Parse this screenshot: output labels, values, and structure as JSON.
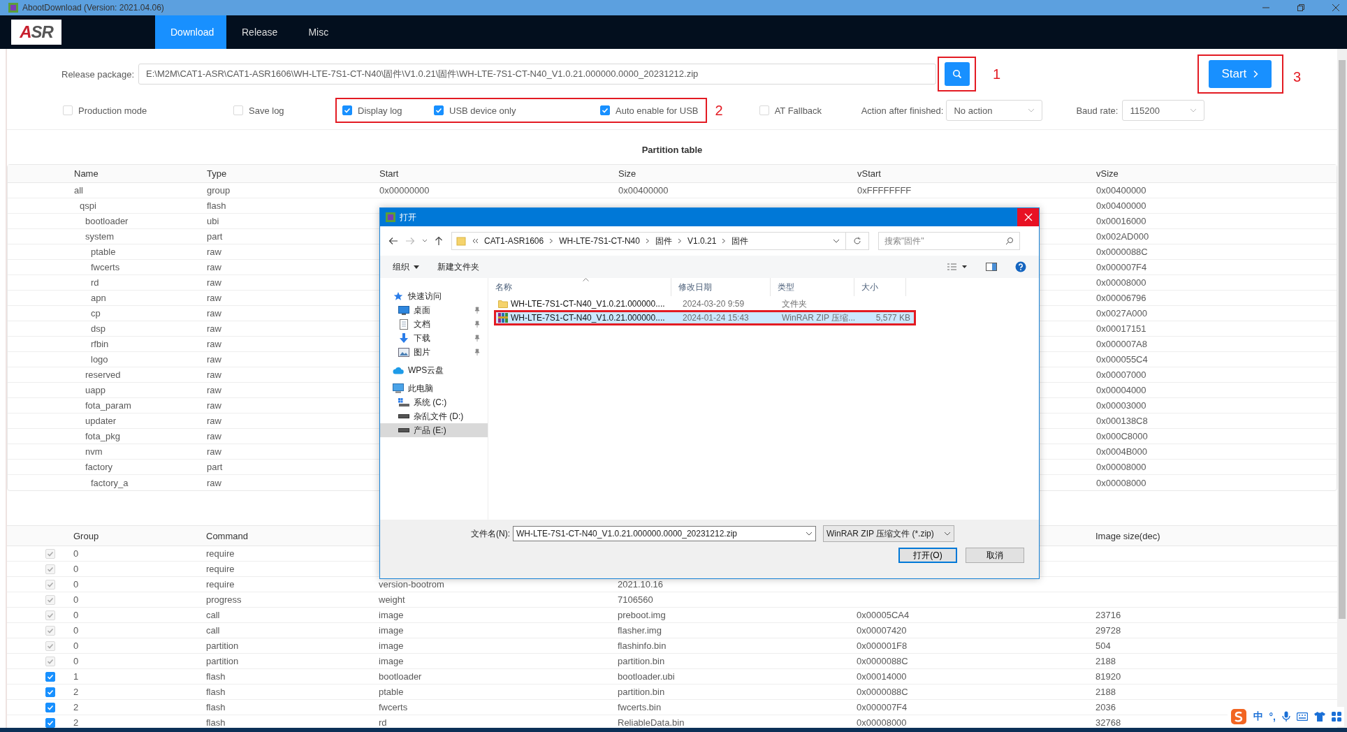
{
  "window": {
    "title": "AbootDownload (Version: 2021.04.06)"
  },
  "logo": {
    "text": "ASR"
  },
  "tabs": [
    {
      "label": "Download",
      "selected": true
    },
    {
      "label": "Release",
      "selected": false
    },
    {
      "label": "Misc",
      "selected": false
    }
  ],
  "release_package": {
    "label": "Release package:",
    "value": "E:\\M2M\\CAT1-ASR\\CAT1-ASR1606\\WH-LTE-7S1-CT-N40\\固件\\V1.0.21\\固件\\WH-LTE-7S1-CT-N40_V1.0.21.000000.0000_20231212.zip",
    "annotation": "1"
  },
  "start_button": {
    "label": "Start",
    "annotation": "3"
  },
  "options": [
    {
      "label": "Production mode",
      "checked": false,
      "highlighted": false
    },
    {
      "label": "Save log",
      "checked": false,
      "highlighted": false
    },
    {
      "label": "Display log",
      "checked": true,
      "highlighted": true
    },
    {
      "label": "USB device only",
      "checked": true,
      "highlighted": true
    },
    {
      "label": "Auto enable for USB",
      "checked": true,
      "highlighted": true
    },
    {
      "label": "AT Fallback",
      "checked": false,
      "highlighted": false
    }
  ],
  "options_annotation": "2",
  "action_after_finished": {
    "label": "Action after finished:",
    "value": "No action"
  },
  "baud_rate": {
    "label": "Baud rate:",
    "value": "115200"
  },
  "partition_table": {
    "title": "Partition table",
    "columns": {
      "name": "Name",
      "type": "Type",
      "start": "Start",
      "size": "Size",
      "vstart": "vStart",
      "vsize": "vSize"
    },
    "rows": [
      {
        "name": "all",
        "type": "group",
        "start": "0x00000000",
        "size": "0x00400000",
        "vstart": "0xFFFFFFFF",
        "vsize": "0x00400000",
        "children": [
          {
            "name": "qspi",
            "type": "flash",
            "vsize": "0x00400000",
            "children": [
              {
                "name": "bootloader",
                "type": "ubi",
                "vsize": "0x00016000"
              },
              {
                "name": "system",
                "type": "part",
                "vsize": "0x002AD000",
                "children": [
                  {
                    "name": "ptable",
                    "type": "raw",
                    "vsize": "0x0000088C"
                  },
                  {
                    "name": "fwcerts",
                    "type": "raw",
                    "vsize": "0x000007F4"
                  },
                  {
                    "name": "rd",
                    "type": "raw",
                    "vsize": "0x00008000"
                  },
                  {
                    "name": "apn",
                    "type": "raw",
                    "vsize": "0x00006796"
                  },
                  {
                    "name": "cp",
                    "type": "raw",
                    "vsize": "0x0027A000"
                  },
                  {
                    "name": "dsp",
                    "type": "raw",
                    "vsize": "0x00017151"
                  },
                  {
                    "name": "rfbin",
                    "type": "raw",
                    "vsize": "0x000007A8"
                  },
                  {
                    "name": "logo",
                    "type": "raw",
                    "vsize": "0x000055C4"
                  }
                ]
              },
              {
                "name": "reserved",
                "type": "raw",
                "vsize": "0x00007000"
              },
              {
                "name": "uapp",
                "type": "raw",
                "vsize": "0x00004000"
              },
              {
                "name": "fota_param",
                "type": "raw",
                "vsize": "0x00003000"
              },
              {
                "name": "updater",
                "type": "raw",
                "vsize": "0x000138C8"
              },
              {
                "name": "fota_pkg",
                "type": "raw",
                "vsize": "0x000C8000"
              },
              {
                "name": "nvm",
                "type": "raw",
                "vsize": "0x0004B000"
              },
              {
                "name": "factory",
                "type": "part",
                "vsize": "0x00008000",
                "children": [
                  {
                    "name": "factory_a",
                    "type": "raw",
                    "vsize": "0x00008000"
                  }
                ]
              }
            ]
          }
        ]
      }
    ]
  },
  "command_table": {
    "columns": {
      "group": "Group",
      "command": "Command",
      "column_6": "Image size(dec)"
    },
    "rows": [
      {
        "checked": true,
        "disabled": true,
        "group": "0",
        "command": "require"
      },
      {
        "checked": true,
        "disabled": true,
        "group": "0",
        "command": "require"
      },
      {
        "checked": true,
        "disabled": true,
        "group": "0",
        "command": "require",
        "column_3": "version-bootrom",
        "column_4": "2021.10.16"
      },
      {
        "checked": true,
        "disabled": true,
        "group": "0",
        "command": "progress",
        "column_3": "weight",
        "column_4": "7106560"
      },
      {
        "checked": true,
        "disabled": true,
        "group": "0",
        "command": "call",
        "column_3": "image",
        "column_4": "preboot.img",
        "column_5": "0x00005CA4",
        "column_6": "23716"
      },
      {
        "checked": true,
        "disabled": true,
        "group": "0",
        "command": "call",
        "column_3": "image",
        "column_4": "flasher.img",
        "column_5": "0x00007420",
        "column_6": "29728"
      },
      {
        "checked": true,
        "disabled": true,
        "group": "0",
        "command": "partition",
        "column_3": "image",
        "column_4": "flashinfo.bin",
        "column_5": "0x000001F8",
        "column_6": "504"
      },
      {
        "checked": true,
        "disabled": true,
        "group": "0",
        "command": "partition",
        "column_3": "image",
        "column_4": "partition.bin",
        "column_5": "0x0000088C",
        "column_6": "2188"
      },
      {
        "checked": true,
        "disabled": false,
        "group": "1",
        "command": "flash",
        "column_3": "bootloader",
        "column_4": "bootloader.ubi",
        "column_5": "0x00014000",
        "column_6": "81920"
      },
      {
        "checked": true,
        "disabled": false,
        "group": "2",
        "command": "flash",
        "column_3": "ptable",
        "column_4": "partition.bin",
        "column_5": "0x0000088C",
        "column_6": "2188"
      },
      {
        "checked": true,
        "disabled": false,
        "group": "2",
        "command": "flash",
        "column_3": "fwcerts",
        "column_4": "fwcerts.bin",
        "column_5": "0x000007F4",
        "column_6": "2036"
      },
      {
        "checked": true,
        "disabled": false,
        "group": "2",
        "command": "flash",
        "column_3": "rd",
        "column_4": "ReliableData.bin",
        "column_5": "0x00008000",
        "column_6": "32768"
      }
    ]
  },
  "open_dialog": {
    "title": "打开",
    "breadcrumb": [
      "CAT1-ASR1606",
      "WH-LTE-7S1-CT-N40",
      "固件",
      "V1.0.21",
      "固件"
    ],
    "search": {
      "placeholder": "搜索\"固件\""
    },
    "toolbar": [
      "组织",
      "新建文件夹"
    ],
    "nav": [
      {
        "label": "快速访问",
        "kind": "star",
        "selected": false,
        "children": [
          {
            "label": "桌面",
            "kind": "desktop",
            "pinned": true,
            "selected": false
          },
          {
            "label": "文档",
            "kind": "document",
            "pinned": true,
            "selected": false
          },
          {
            "label": "下载",
            "kind": "download",
            "pinned": true,
            "selected": false
          },
          {
            "label": "图片",
            "kind": "picture",
            "pinned": true,
            "selected": false
          }
        ]
      },
      {
        "label": "WPS云盘",
        "kind": "cloud",
        "selected": false
      },
      {
        "label": "此电脑",
        "kind": "computer",
        "selected": false,
        "children": [
          {
            "label": "系统 (C:)",
            "kind": "system-drive",
            "selected": false
          },
          {
            "label": "杂乱文件 (D:)",
            "kind": "drive",
            "selected": false
          },
          {
            "label": "产品 (E:)",
            "kind": "drive",
            "selected": true
          }
        ]
      }
    ],
    "columns": [
      "名称",
      "修改日期",
      "类型",
      "大小"
    ],
    "files": [
      {
        "kind": "folder",
        "name": "WH-LTE-7S1-CT-N40_V1.0.21.000000....",
        "date": "2024-03-20 9:59",
        "type": "文件夹",
        "selected": false
      },
      {
        "kind": "archive",
        "name": "WH-LTE-7S1-CT-N40_V1.0.21.000000....",
        "date": "2024-01-24 15:43",
        "type": "WinRAR ZIP 压缩...",
        "size": "5,577 KB",
        "selected": true
      }
    ],
    "filename_label": "文件名(N):",
    "filename": "WH-LTE-7S1-CT-N40_V1.0.21.000000.0000_20231212.zip",
    "filetype": "WinRAR ZIP 压缩文件 (*.zip)",
    "buttons": [
      {
        "label": "打开(O)",
        "kind": "primary"
      },
      {
        "label": "取消",
        "kind": "normal"
      }
    ]
  },
  "ime_bar": [
    {
      "kind": "logo"
    },
    {
      "kind": "text",
      "text": "中"
    },
    {
      "kind": "text",
      "text": "°,"
    },
    {
      "kind": "mic"
    },
    {
      "kind": "keyboard"
    },
    {
      "kind": "skin"
    },
    {
      "kind": "apps"
    }
  ]
}
